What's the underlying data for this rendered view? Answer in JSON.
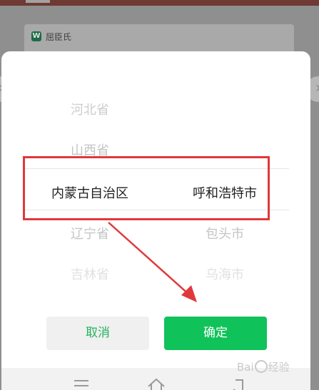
{
  "background": {
    "card_label": "屈臣氏",
    "card_logo_letter": "W"
  },
  "picker": {
    "province_column": [
      "河北省",
      "山西省",
      "内蒙古自治区",
      "辽宁省",
      "吉林省"
    ],
    "city_column": [
      "呼和浩特市",
      "包头市",
      "乌海市"
    ],
    "selected_province": "内蒙古自治区",
    "selected_city": "呼和浩特市"
  },
  "actions": {
    "cancel_label": "取消",
    "confirm_label": "确定"
  },
  "nav": {
    "icons": [
      "menu-icon",
      "home-icon",
      "back-icon"
    ]
  },
  "watermark": {
    "text_left": "Bai",
    "text_right": "经验"
  },
  "colors": {
    "confirm_bg": "#10c25a",
    "cancel_text": "#25b25f",
    "highlight": "#e0393b"
  }
}
